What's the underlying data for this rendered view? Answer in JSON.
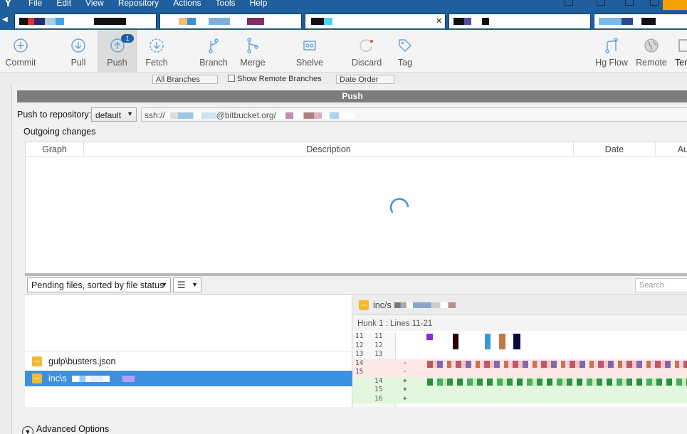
{
  "menu": [
    "File",
    "Edit",
    "View",
    "Repository",
    "Actions",
    "Tools",
    "Help"
  ],
  "tabs": [
    {
      "id": "tab-1",
      "active": false
    },
    {
      "id": "tab-2",
      "active": false
    },
    {
      "id": "tab-3",
      "active": true,
      "close_glyph": "×"
    },
    {
      "id": "tab-4",
      "active": false
    },
    {
      "id": "tab-5",
      "active": false
    }
  ],
  "toolbar": {
    "commit": "Commit",
    "pull": "Pull",
    "push": "Push",
    "push_badge": "1",
    "fetch": "Fetch",
    "branch": "Branch",
    "merge": "Merge",
    "shelve": "Shelve",
    "discard": "Discard",
    "tag": "Tag",
    "hgflow": "Hg Flow",
    "remote": "Remote",
    "terminal": "Term"
  },
  "filterbar": {
    "branches": "All Branches",
    "show_remote": "Show Remote Branches",
    "order": "Date Order"
  },
  "dialog": {
    "title": "Push",
    "push_to_label": "Push to repository:",
    "repo_value": "default",
    "url_prefix": "ssh://",
    "url_host": "@bitbucket.org/",
    "outgoing_label": "Outgoing changes",
    "columns": {
      "graph": "Graph",
      "description": "Description",
      "date": "Date",
      "author": "Au"
    },
    "pending_select": "Pending files, sorted by file status",
    "search_placeholder": "Search",
    "files": [
      {
        "name": "gulp\\busters.json",
        "selected": false
      },
      {
        "name": "inc\\s",
        "selected": true
      }
    ],
    "diff_file": "inc/s",
    "hunk": "Hunk 1 : Lines 11-21",
    "diff_lines": [
      {
        "n1": "11",
        "n2": "11",
        "sign": "",
        "type": "ctx"
      },
      {
        "n1": "12",
        "n2": "12",
        "sign": "",
        "type": "ctx"
      },
      {
        "n1": "13",
        "n2": "13",
        "sign": "",
        "type": "ctx"
      },
      {
        "n1": "14",
        "n2": "",
        "sign": "-",
        "type": "del"
      },
      {
        "n1": "15",
        "n2": "",
        "sign": "-",
        "type": "del"
      },
      {
        "n1": "",
        "n2": "14",
        "sign": "+",
        "type": "add"
      },
      {
        "n1": "",
        "n2": "15",
        "sign": "+",
        "type": "add"
      },
      {
        "n1": "",
        "n2": "16",
        "sign": "+",
        "type": "add"
      }
    ],
    "advanced": "Advanced Options"
  },
  "colors": {
    "menubar": "#205f9e",
    "selection": "#3d8fe0",
    "badge": "#1e5fa6",
    "file_status": "#f5b833"
  }
}
